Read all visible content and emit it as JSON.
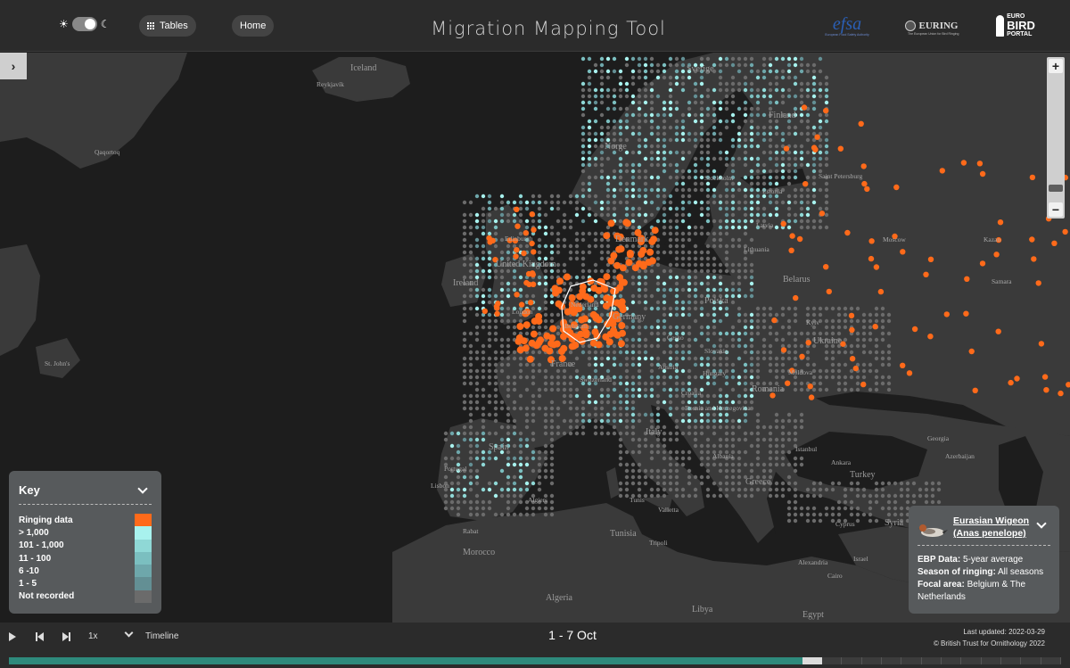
{
  "header": {
    "title": "Migration Mapping Tool",
    "tables_label": "Tables",
    "home_label": "Home",
    "logos": {
      "efsa": "efsa",
      "efsa_sub": "European Food Safety Authority",
      "euring": "EURING",
      "euring_sub": "The European Union for Bird Ringing",
      "ebp_line1": "EURO",
      "ebp_line2": "BIRD",
      "ebp_line3": "PORTAL"
    }
  },
  "map": {
    "labels": [
      {
        "text": "Iceland"
      },
      {
        "text": "Reykjavík"
      },
      {
        "text": "Qaqortoq"
      },
      {
        "text": "Sverige"
      },
      {
        "text": "Norge"
      },
      {
        "text": "Finland"
      },
      {
        "text": "Stockholm"
      },
      {
        "text": "Saint Petersburg"
      },
      {
        "text": "Estonia"
      },
      {
        "text": "Latvia"
      },
      {
        "text": "Lithuania"
      },
      {
        "text": "Denmark"
      },
      {
        "text": "United Kingdom"
      },
      {
        "text": "Ireland"
      },
      {
        "text": "Edinburgh"
      },
      {
        "text": "London"
      },
      {
        "text": "Nederland"
      },
      {
        "text": "Belgium"
      },
      {
        "text": "Germany"
      },
      {
        "text": "Polska"
      },
      {
        "text": "Belarus"
      },
      {
        "text": "Moscow"
      },
      {
        "text": "Kazan"
      },
      {
        "text": "Samara"
      },
      {
        "text": "Kyiv"
      },
      {
        "text": "Ukraine"
      },
      {
        "text": "Moldova"
      },
      {
        "text": "Romania"
      },
      {
        "text": "France"
      },
      {
        "text": "Switzerland"
      },
      {
        "text": "Česko"
      },
      {
        "text": "Austria"
      },
      {
        "text": "Hungary"
      },
      {
        "text": "Slovakia"
      },
      {
        "text": "Croatia"
      },
      {
        "text": "Bosnia and Herzegovina"
      },
      {
        "text": "Italy"
      },
      {
        "text": "Spain"
      },
      {
        "text": "Portugal"
      },
      {
        "text": "Lisbon"
      },
      {
        "text": "Albania"
      },
      {
        "text": "Greece"
      },
      {
        "text": "Turkey"
      },
      {
        "text": "Ankara"
      },
      {
        "text": "Istanbul"
      },
      {
        "text": "Georgia"
      },
      {
        "text": "Azerbaijan"
      },
      {
        "text": "Syria"
      },
      {
        "text": "Cyprus"
      },
      {
        "text": "Israel"
      },
      {
        "text": "Algiers"
      },
      {
        "text": "Tunis"
      },
      {
        "text": "Valletta"
      },
      {
        "text": "Tunisia"
      },
      {
        "text": "Tripoli"
      },
      {
        "text": "Rabat"
      },
      {
        "text": "Morocco"
      },
      {
        "text": "Algeria"
      },
      {
        "text": "Libya"
      },
      {
        "text": "Egypt"
      },
      {
        "text": "Alexandria"
      },
      {
        "text": "Cairo"
      },
      {
        "text": "St. John's"
      }
    ]
  },
  "key": {
    "title": "Key",
    "rows": [
      {
        "label": "Ringing data",
        "color": "#ff6a1a"
      },
      {
        "label": "> 1,000",
        "color": "#a8f2ee"
      },
      {
        "label": "101 - 1,000",
        "color": "#8fd8d6"
      },
      {
        "label": "11 - 100",
        "color": "#7bbfc0"
      },
      {
        "label": "6 -10",
        "color": "#6ea7ab"
      },
      {
        "label": "1 - 5",
        "color": "#638f94"
      },
      {
        "label": "Not recorded",
        "color": "#6b6b6b"
      }
    ]
  },
  "info": {
    "species_line1": "Eurasian Wigeon",
    "species_line2": "(Anas penelope)",
    "ebp_label": "EBP Data:",
    "ebp_value": "5-year average",
    "season_label": "Season of ringing:",
    "season_value": "All seasons",
    "focal_label": "Focal area:",
    "focal_value": "Belgium & The Netherlands"
  },
  "timeline": {
    "speed": "1x",
    "label": "Timeline",
    "period": "1 - 7 Oct",
    "last_updated": "Last updated:  2022-03-29",
    "copyright": "© British Trust for Ornithology 2022",
    "progress_fraction": 0.763,
    "total_steps": 52
  },
  "colors": {
    "accent_orange": "#ff6a1a",
    "teal_fill": "#2e8a7c",
    "panel": "#575a5c"
  }
}
